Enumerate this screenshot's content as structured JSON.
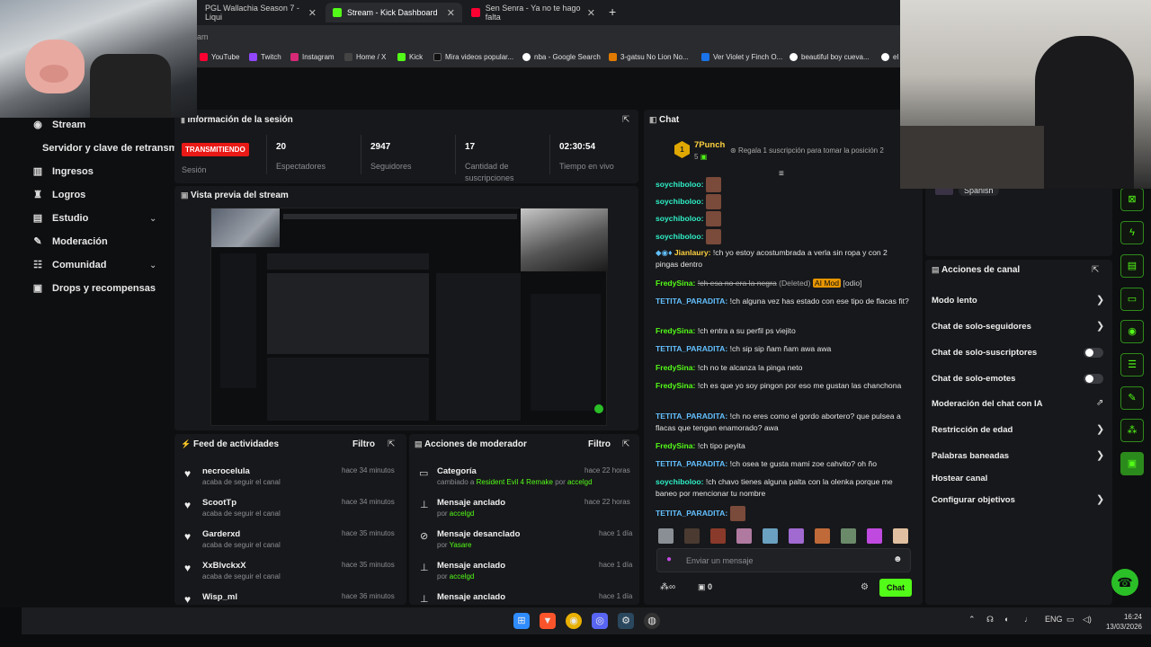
{
  "browser": {
    "tabs": [
      {
        "label": "PGL Wallachia Season 7 - Liqui",
        "active": false
      },
      {
        "label": "Stream - Kick Dashboard",
        "active": true
      },
      {
        "label": "Sen Senra - Ya no te hago falta",
        "active": false
      }
    ],
    "new_tab": "+",
    "address": "eam",
    "bookmarks": [
      "YouTube",
      "Twitch",
      "Instagram",
      "Home / X",
      "Kick",
      "Mira videos popular...",
      "nba - Google Search",
      "3-gatsu No Lion No...",
      "Ver Violet y Finch O...",
      "beautiful boy cueva...",
      "el"
    ]
  },
  "sidebar": {
    "items": [
      {
        "label": "Stream",
        "icon": "broadcast-icon"
      },
      {
        "label": "Servidor y clave de retransm",
        "icon": ""
      },
      {
        "label": "Ingresos",
        "icon": "chart-icon"
      },
      {
        "label": "Logros",
        "icon": "trophy-icon"
      },
      {
        "label": "Estudio",
        "icon": "studio-icon"
      },
      {
        "label": "Moderación",
        "icon": "wrench-icon"
      },
      {
        "label": "Comunidad",
        "icon": "community-icon"
      },
      {
        "label": "Drops y recompensas",
        "icon": "gift-icon"
      }
    ]
  },
  "session": {
    "title": "Información de la sesión",
    "live_badge": "TRANSMITIENDO",
    "live_label": "Sesión",
    "stats": [
      {
        "value": "20",
        "label": "Espectadores"
      },
      {
        "value": "2947",
        "label": "Seguidores"
      },
      {
        "value": "17",
        "label": "Cantidad de suscripciones"
      },
      {
        "value": "02:30:54",
        "label": "Tiempo en vivo"
      }
    ]
  },
  "preview": {
    "title": "Vista previa del stream"
  },
  "feed": {
    "title": "Feed de actividades",
    "filter": "Filtro",
    "items": [
      {
        "name": "necrocelula",
        "sub": "acaba de seguir el canal",
        "time": "hace 34 minutos"
      },
      {
        "name": "ScootTp",
        "sub": "acaba de seguir el canal",
        "time": "hace 34 minutos"
      },
      {
        "name": "Garderxd",
        "sub": "acaba de seguir el canal",
        "time": "hace 35 minutos"
      },
      {
        "name": "XxBlvckxX",
        "sub": "acaba de seguir el canal",
        "time": "hace 35 minutos"
      },
      {
        "name": "Wisp_ml",
        "sub": "",
        "time": "hace 36 minutos"
      }
    ]
  },
  "modactions": {
    "title": "Acciones de moderador",
    "filter": "Filtro",
    "items": [
      {
        "title": "Categoría",
        "sub_prefix": "cambiado a ",
        "sub_highlight": "Resident Evil 4 Remake",
        "sub_mid": " por ",
        "sub_user": "accelgd",
        "time": "hace 22 horas"
      },
      {
        "title": "Mensaje anclado",
        "sub_prefix": "por ",
        "sub_user": "accelgd",
        "time": "hace 22 horas"
      },
      {
        "title": "Mensaje desanclado",
        "sub_prefix": "por ",
        "sub_user": "Yasare",
        "time": "hace 1 día"
      },
      {
        "title": "Mensaje anclado",
        "sub_prefix": "por ",
        "sub_user": "accelgd",
        "time": "hace 1 día"
      },
      {
        "title": "Mensaje anclado",
        "sub_prefix": "",
        "sub_user": "",
        "time": "hace 1 día"
      }
    ]
  },
  "chat": {
    "title": "Chat",
    "top_gifter": {
      "name": "7Punch",
      "count": "5",
      "message": "Regala 1 suscripción para tomar la posición 2"
    },
    "messages": [
      {
        "user": "soychiboloo:",
        "text": ""
      },
      {
        "user": "soychiboloo:",
        "text": ""
      },
      {
        "user": "soychiboloo:",
        "text": ""
      },
      {
        "user": "soychiboloo:",
        "text": ""
      },
      {
        "user": "Jianlaury:",
        "text": "!ch yo estoy acostumbrada a verla sin ropa y con 2 pingas dentro"
      },
      {
        "user": "FredySina:",
        "text": "!ch esa no era la negra",
        "deleted": "(Deleted)",
        "mod_tag": "AI Mod",
        "reason": "[odio]"
      },
      {
        "user": "TETITA_PARADITA:",
        "text": "!ch alguna vez has estado con ese tipo de flacas fit?"
      },
      {
        "user": "FredySina:",
        "text": "!ch entra a su perfil ps viejito"
      },
      {
        "user": "TETITA_PARADITA:",
        "text": "!ch sip sip ñam ñam awa awa"
      },
      {
        "user": "FredySina:",
        "text": "!ch no te alcanza la pinga neto"
      },
      {
        "user": "FredySina:",
        "text": "!ch es que yo soy pingon por eso me gustan las chanchona"
      },
      {
        "user": "TETITA_PARADITA:",
        "text": "!ch no eres como el gordo abortero? que pulsea a flacas que tengan enamorado? awa"
      },
      {
        "user": "FredySina:",
        "text": "!ch tipo peyita"
      },
      {
        "user": "TETITA_PARADITA:",
        "text": "!ch osea te gusta mami zoe cahvito? oh ño"
      },
      {
        "user": "soychiboloo:",
        "text": "!ch chavo tienes alguna palta con la olenka porque me baneo por mencionar tu nombre"
      },
      {
        "user": "TETITA_PARADITA:",
        "text": ""
      }
    ],
    "input_placeholder": "Enviar un mensaje",
    "points": "0",
    "send_label": "Chat"
  },
  "channel_actions": {
    "language": "Spanish",
    "title": "Acciones de canal",
    "rows": [
      {
        "label": "Modo lento",
        "control": "chevron"
      },
      {
        "label": "Chat de solo-seguidores",
        "control": "chevron"
      },
      {
        "label": "Chat de solo-suscriptores",
        "control": "toggle"
      },
      {
        "label": "Chat de solo-emotes",
        "control": "toggle"
      },
      {
        "label": "Moderación del chat con IA",
        "control": "external"
      },
      {
        "label": "Restricción de edad",
        "control": "chevron"
      },
      {
        "label": "Palabras baneadas",
        "control": "chevron"
      },
      {
        "label": "Hostear canal",
        "control": "none"
      },
      {
        "label": "Configurar objetivos",
        "control": "chevron"
      }
    ]
  },
  "taskbar": {
    "language": "ENG",
    "time": "16:24",
    "date": "13/03/2026"
  },
  "colors": {
    "accent": "#53fc18",
    "live": "#e91916",
    "bg": "#0e0f11",
    "panel": "#17181b"
  }
}
